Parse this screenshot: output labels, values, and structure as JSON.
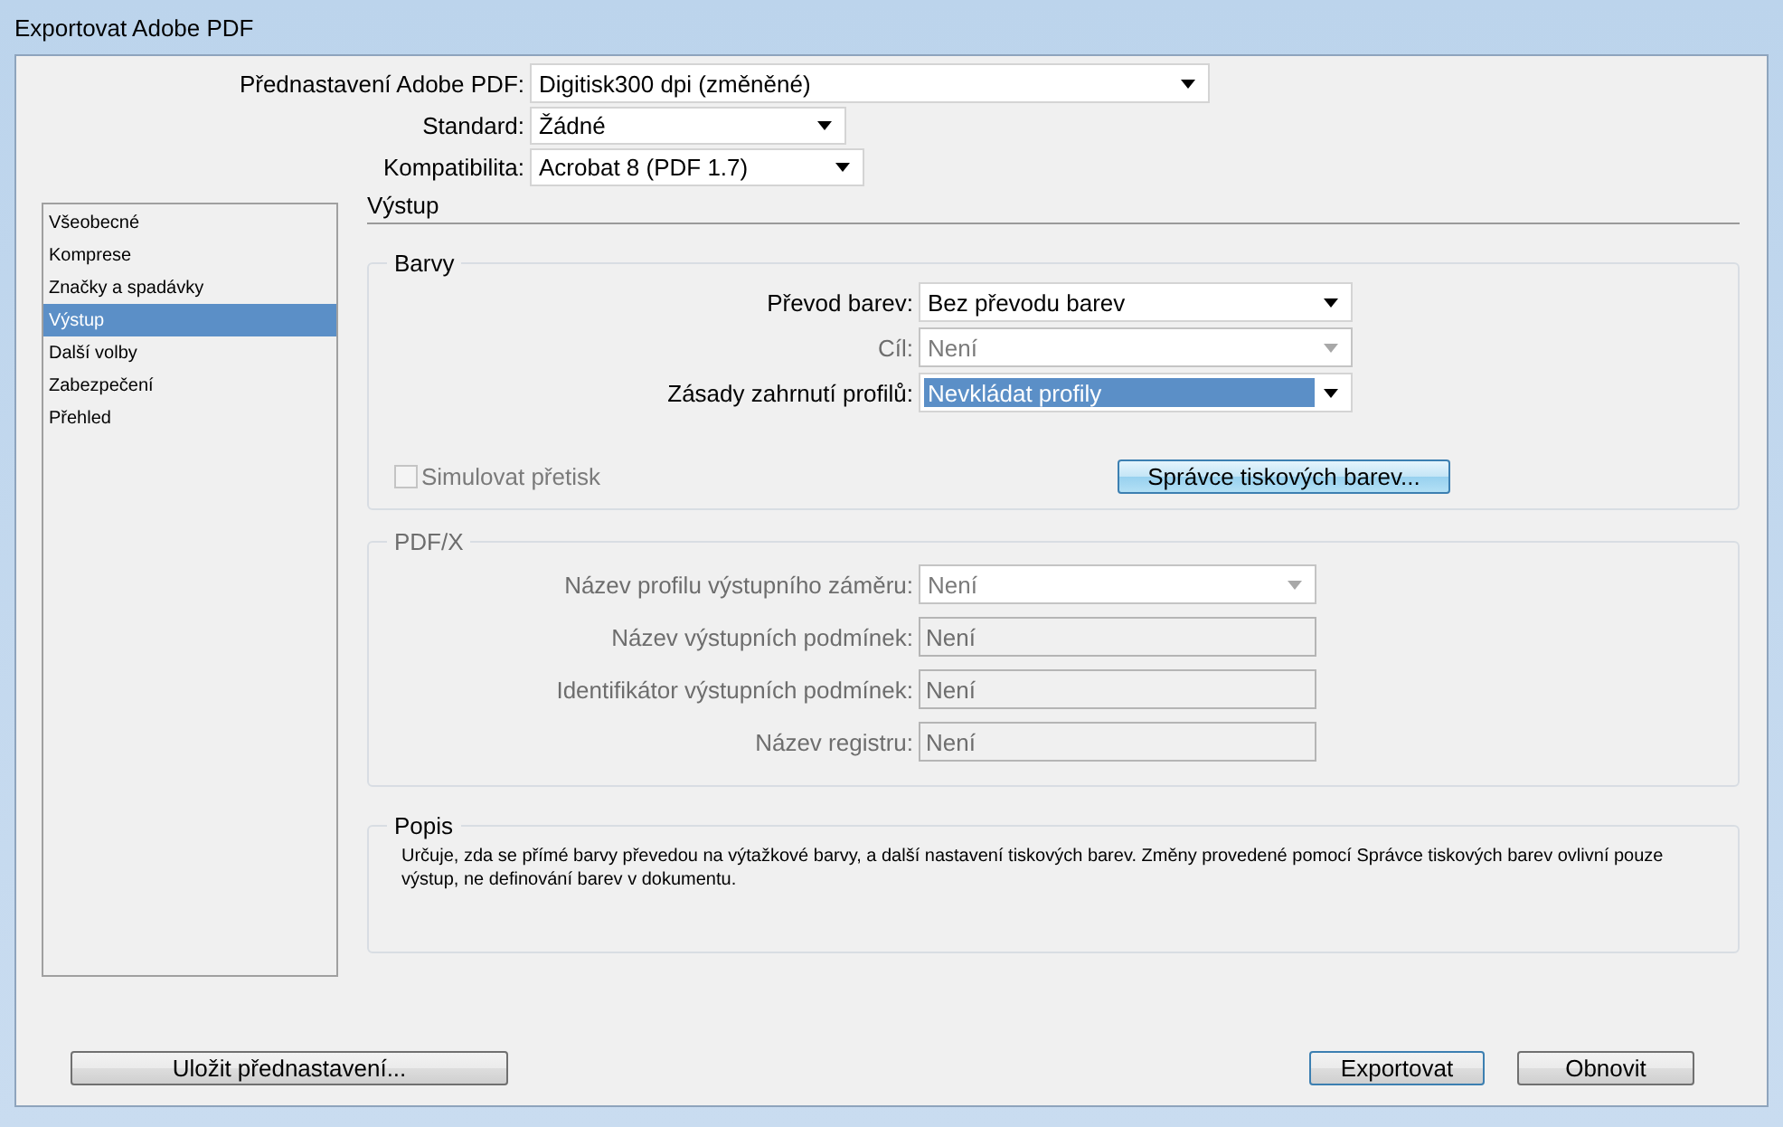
{
  "window": {
    "title": "Exportovat Adobe PDF"
  },
  "presets": [
    {
      "label": "Přednastavení Adobe PDF:",
      "value": "Digitisk300 dpi (změněné)"
    },
    {
      "label": "Standard:",
      "value": "Žádné"
    },
    {
      "label": "Kompatibilita:",
      "value": "Acrobat 8 (PDF 1.7)"
    }
  ],
  "sidebar": {
    "items": [
      {
        "label": "Všeobecné",
        "selected": false
      },
      {
        "label": "Komprese",
        "selected": false
      },
      {
        "label": "Značky a spadávky",
        "selected": false
      },
      {
        "label": "Výstup",
        "selected": true
      },
      {
        "label": "Další volby",
        "selected": false
      },
      {
        "label": "Zabezpečení",
        "selected": false
      },
      {
        "label": "Přehled",
        "selected": false
      }
    ]
  },
  "section_title": "Výstup",
  "colors_group": {
    "title": "Barvy",
    "fields": [
      {
        "label": "Převod barev:",
        "value": "Bez převodu barev",
        "kind": "select",
        "disabled": false,
        "focused": false
      },
      {
        "label": "Cíl:",
        "value": "Není",
        "kind": "select",
        "disabled": true,
        "focused": false
      },
      {
        "label": "Zásady zahrnutí profilů:",
        "value": "Nevkládat profily",
        "kind": "select",
        "disabled": false,
        "focused": true
      }
    ],
    "checkbox": {
      "label": "Simulovat přetisk",
      "checked": false,
      "disabled": true
    },
    "button": "Správce tiskových barev..."
  },
  "pdfx_group": {
    "title": "PDF/X",
    "fields": [
      {
        "label": "Název profilu výstupního záměru:",
        "value": "Není",
        "kind": "select",
        "disabled": true
      },
      {
        "label": "Název výstupních podmínek:",
        "value": "Není",
        "kind": "text",
        "disabled": true
      },
      {
        "label": "Identifikátor výstupních podmínek:",
        "value": "Není",
        "kind": "text",
        "disabled": true
      },
      {
        "label": "Název registru:",
        "value": "Není",
        "kind": "text",
        "disabled": true
      }
    ]
  },
  "description": {
    "title": "Popis",
    "text": "Určuje, zda se přímé barvy převedou na výtažkové barvy, a další nastavení tiskových barev. Změny provedené pomocí Správce tiskových barev ovlivní pouze výstup, ne definování barev v dokumentu."
  },
  "buttons": [
    {
      "label": "Uložit přednastavení...",
      "default": false
    },
    {
      "label": "Exportovat",
      "default": true
    },
    {
      "label": "Obnovit",
      "default": false
    }
  ]
}
